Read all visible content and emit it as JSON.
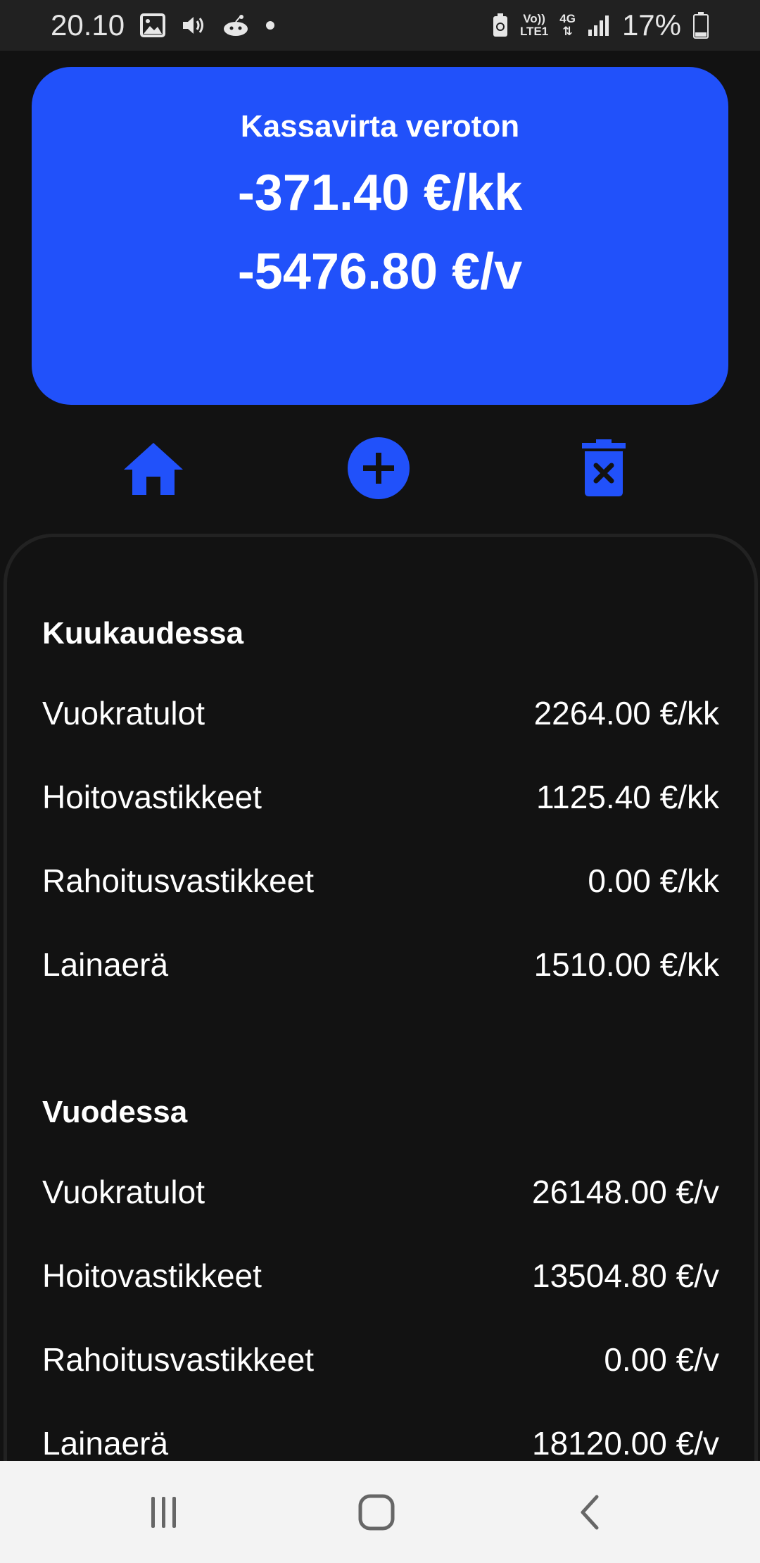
{
  "status_bar": {
    "time": "20.10",
    "network_top": "Vo))",
    "network_bottom": "LTE1",
    "network_type": "4G",
    "battery_percent": "17%",
    "icons": [
      "image-icon",
      "volume-icon",
      "reddit-icon",
      "notification-dot-icon",
      "data-saver-icon",
      "signal-icon",
      "battery-icon"
    ]
  },
  "summary": {
    "title": "Kassavirta veroton",
    "monthly": "-371.40 €/kk",
    "yearly": "-5476.80 €/v"
  },
  "actions": {
    "icons": [
      "home-icon",
      "add-circle-icon",
      "delete-icon"
    ]
  },
  "monthly": {
    "heading": "Kuukaudessa",
    "rows": [
      {
        "label": "Vuokratulot",
        "value": "2264.00 €/kk"
      },
      {
        "label": "Hoitovastikkeet",
        "value": "1125.40 €/kk"
      },
      {
        "label": "Rahoitusvastikkeet",
        "value": "0.00 €/kk"
      },
      {
        "label": "Lainaerä",
        "value": "1510.00 €/kk"
      }
    ]
  },
  "yearly": {
    "heading": "Vuodessa",
    "rows": [
      {
        "label": "Vuokratulot",
        "value": "26148.00 €/v"
      },
      {
        "label": "Hoitovastikkeet",
        "value": "13504.80 €/v"
      },
      {
        "label": "Rahoitusvastikkeet",
        "value": "0.00 €/v"
      },
      {
        "label": "Lainaerä",
        "value": "18120.00 €/v"
      }
    ]
  },
  "nav": {
    "icons": [
      "recent-apps-icon",
      "home-button-icon",
      "back-icon"
    ]
  },
  "colors": {
    "accent": "#2151fa",
    "background": "#121212",
    "status_bar": "#212121",
    "nav_bar": "#f3f3f3"
  }
}
